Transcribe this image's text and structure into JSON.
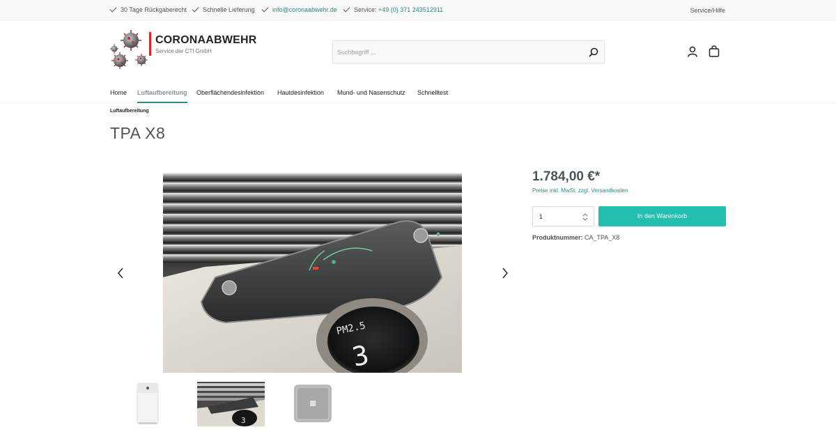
{
  "topbar": {
    "usps": [
      {
        "text": "30 Tage Rückgaberecht",
        "link": false
      },
      {
        "text": "Schnelle Lieferung",
        "link": false
      },
      {
        "text": "info@coronaabwehr.de",
        "link": true
      },
      {
        "prefix": "Service: ",
        "text": "+49 (0) 371 243512911",
        "link": true
      }
    ],
    "service_help": "Service/Hilfe"
  },
  "header": {
    "brand_name": "CORONAABWEHR",
    "brand_sub": "Service der CTI GmbH",
    "search_placeholder": "Suchbegriff ...",
    "search_icon": "search-icon",
    "account_icon": "user-icon",
    "cart_icon": "shopping-bag-icon"
  },
  "nav": {
    "items": [
      "Home",
      "Luftaufbereitung",
      "Oberflächendesinfektion",
      "Hautdesinfektion",
      "Mund- und Nasenschutz",
      "Schnelltest"
    ],
    "active": "Luftaufbereitung"
  },
  "breadcrumb": "Luftaufbereitung",
  "product": {
    "title": "TPA X8",
    "price": "1.784,00 €*",
    "tax_note": "Preise inkl. MwSt. zzgl. Versandkosten",
    "quantity": "1",
    "add_to_cart": "In den Warenkorb",
    "sku_label": "Produktnummer:",
    "sku_value": "CA_TPA_X8",
    "display_text_1": "PM2.5",
    "display_text_2": "3"
  },
  "colors": {
    "accent": "#23beb0",
    "link": "#2a8a83",
    "logo_red": "#e3202a",
    "text": "#4a545b"
  }
}
